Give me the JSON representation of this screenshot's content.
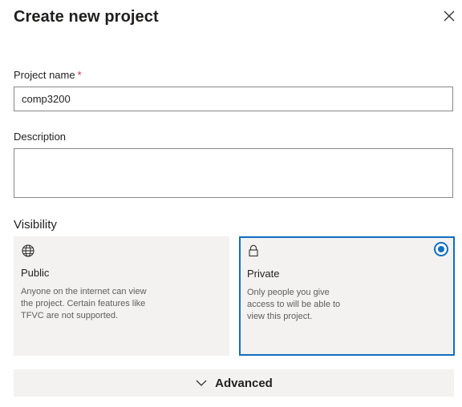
{
  "dialog": {
    "title": "Create new project",
    "close_icon": "close-icon"
  },
  "form": {
    "project_name": {
      "label": "Project name",
      "required_marker": "*",
      "value": "comp3200"
    },
    "description": {
      "label": "Description",
      "value": ""
    }
  },
  "visibility": {
    "title": "Visibility",
    "options": [
      {
        "icon": "globe-icon",
        "title": "Public",
        "description": "Anyone on the internet can view the project. Certain features like TFVC are not supported.",
        "selected": false
      },
      {
        "icon": "lock-icon",
        "title": "Private",
        "description": "Only people you give access to will be able to view this project.",
        "selected": true
      }
    ]
  },
  "advanced": {
    "icon": "chevron-down-icon",
    "label": "Advanced"
  },
  "colors": {
    "accent": "#106ebe",
    "required": "#c4314b",
    "card_background": "#f3f2f1",
    "border": "#8a8886"
  }
}
